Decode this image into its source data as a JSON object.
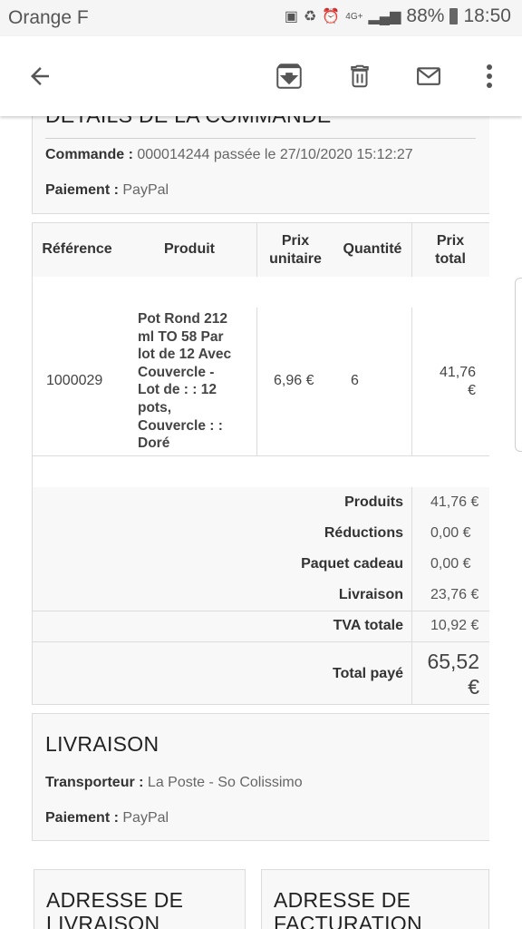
{
  "status": {
    "carrier": "Orange F",
    "network": "4G+",
    "battery": "88%",
    "time": "18:50"
  },
  "app_bar": {
    "icons": [
      "arrow-back-icon",
      "archive-icon",
      "delete-icon",
      "mail-icon",
      "more-vert-icon"
    ]
  },
  "order": {
    "title": "DÉTAILS DE LA COMMANDE",
    "order_label": "Commande :",
    "order_value": "000014244 passée le 27/10/2020 15:12:27",
    "payment_label": "Paiement :",
    "payment_value": "PayPal"
  },
  "table": {
    "headers": {
      "reference": "Référence",
      "product": "Produit",
      "unit_price_1": "Prix",
      "unit_price_2": "unitaire",
      "quantity": "Quantité",
      "total_1": "Prix",
      "total_2": "total"
    },
    "row": {
      "reference": "1000029",
      "product_lines": [
        "Pot Rond 212",
        "ml TO 58 Par",
        "lot de 12 Avec",
        "Couvercle -",
        "Lot de : : 12",
        "pots,",
        "Couvercle : :",
        "Doré"
      ],
      "unit_price": "6,96 €",
      "quantity": "6",
      "total_1": "41,76",
      "total_2": "€"
    }
  },
  "totals": {
    "products_label": "Produits",
    "products_value": "41,76 €",
    "discounts_label": "Réductions",
    "discounts_value": "0,00 €",
    "gift_label": "Paquet cadeau",
    "gift_value": "0,00 €",
    "shipping_label": "Livraison",
    "shipping_value": "23,76 €",
    "vat_label": "TVA totale",
    "vat_value": "10,92 €",
    "paid_label": "Total payé",
    "paid_value_1": "65,52",
    "paid_value_2": "€"
  },
  "delivery": {
    "title": "LIVRAISON",
    "carrier_label": "Transporteur :",
    "carrier_value": "La Poste - So Colissimo",
    "payment_label": "Paiement :",
    "payment_value": "PayPal"
  },
  "addresses": {
    "shipping_title_1": "ADRESSE DE",
    "shipping_title_2": "LIVRAISON",
    "billing_title_1": "ADRESSE DE",
    "billing_title_2": "FACTURATION"
  }
}
